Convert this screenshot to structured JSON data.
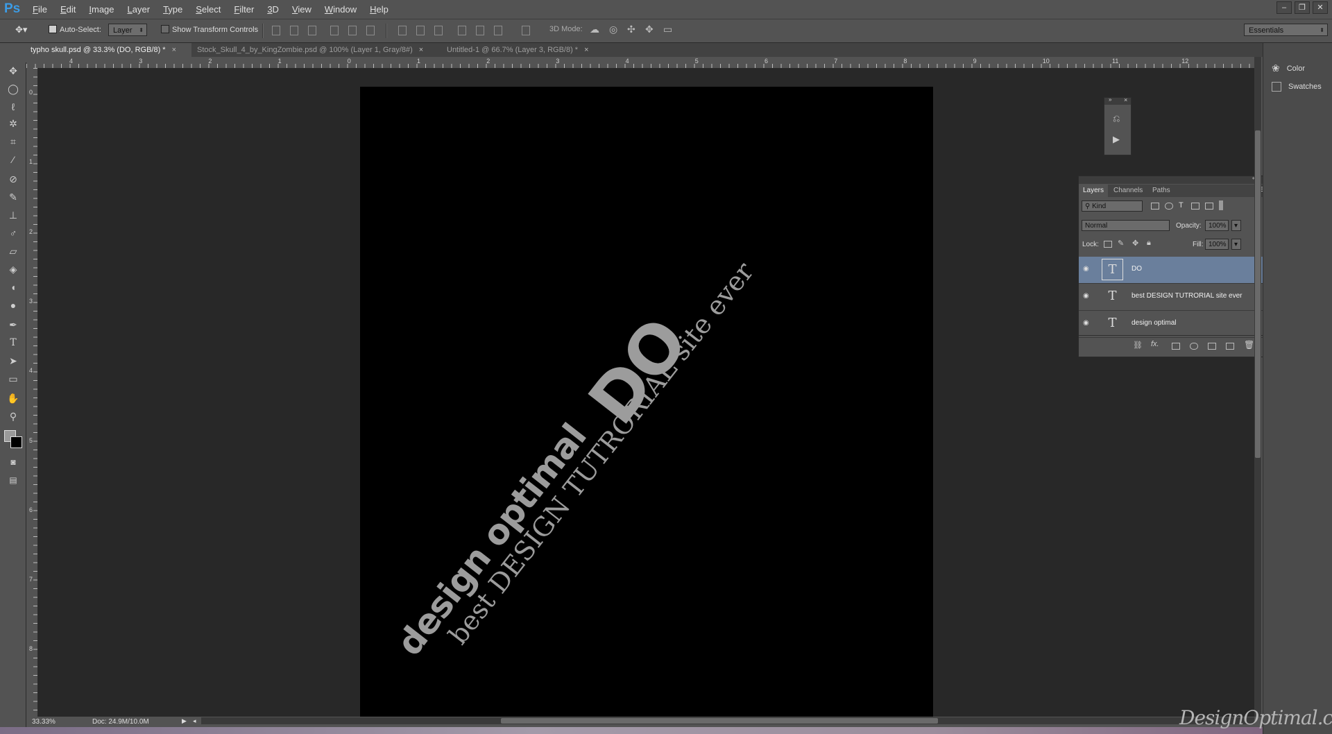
{
  "app": {
    "logo": "Ps"
  },
  "menu": [
    "File",
    "Edit",
    "Image",
    "Layer",
    "Type",
    "Select",
    "Filter",
    "3D",
    "View",
    "Window",
    "Help"
  ],
  "options_bar": {
    "auto_select_label": "Auto-Select:",
    "auto_select_value": "Layer",
    "show_transform_label": "Show Transform Controls",
    "mode_3d_label": "3D Mode:",
    "workspace": "Essentials"
  },
  "tabs": [
    {
      "label": "typho skull.psd @ 33.3% (DO, RGB/8) *"
    },
    {
      "label": "Stock_Skull_4_by_KingZombie.psd @ 100% (Layer 1, Gray/8#)"
    },
    {
      "label": "Untitled-1 @ 66.7% (Layer 3, RGB/8) *"
    }
  ],
  "ruler_top": [
    "4",
    "3",
    "2",
    "1",
    "0",
    "1",
    "2",
    "3",
    "4",
    "5",
    "6",
    "7",
    "8",
    "9",
    "10",
    "11",
    "12"
  ],
  "ruler_left": [
    "0",
    "1",
    "2",
    "3",
    "4",
    "5",
    "6",
    "7",
    "8"
  ],
  "canvas_text": {
    "do": "DO",
    "design": "design optimal",
    "tagline": "best DESIGN TUTRORIAL site ever"
  },
  "status": {
    "zoom": "33.33%",
    "doc": "Doc: 24.9M/10.0M"
  },
  "right_dock": [
    {
      "label": "Color",
      "icon": "color-icon"
    },
    {
      "label": "Swatches",
      "icon": "swatches-icon"
    }
  ],
  "layers_panel": {
    "tabs": [
      "Layers",
      "Channels",
      "Paths"
    ],
    "filter_kind": "Kind",
    "blend_mode": "Normal",
    "opacity_label": "Opacity:",
    "opacity_value": "100%",
    "lock_label": "Lock:",
    "fill_label": "Fill:",
    "fill_value": "100%",
    "layers": [
      {
        "name": "DO",
        "type_glyph": "T",
        "selected": true
      },
      {
        "name": "best DESIGN TUTRORIAL site ever",
        "type_glyph": "T",
        "selected": false
      },
      {
        "name": "design optimal",
        "type_glyph": "T",
        "selected": false
      }
    ]
  },
  "watermark": "DesignOptimal.com"
}
